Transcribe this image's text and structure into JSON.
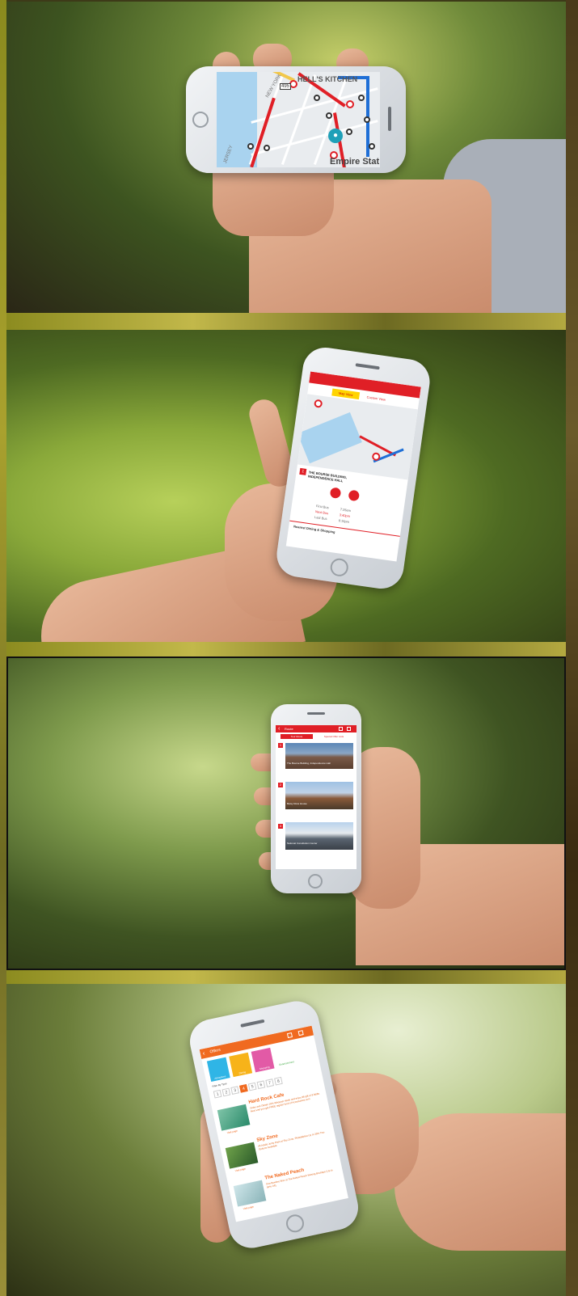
{
  "panel1": {
    "map": {
      "labels": [
        "HELL'S KITCHEN",
        "NEW YORK",
        "495",
        "JERSEY",
        "Empire Stat"
      ]
    }
  },
  "panel2": {
    "toggle": {
      "map_view": "Map View",
      "custom_view": "Custom View"
    },
    "stop_number": "1",
    "stop_name": "THE BOURSE BUILDING, INDEPENDENCE HALL",
    "times": [
      {
        "label": "First Bus",
        "time": "7:25am"
      },
      {
        "label": "Next Bus",
        "time": "3:40pm"
      },
      {
        "label": "Last Bus",
        "time": "6:15pm"
      }
    ],
    "footer": "Nearest Dining & Shopping"
  },
  "panel3": {
    "header": {
      "back_icon": "chevron-left-icon",
      "title": "Route"
    },
    "tabs": [
      "Tour Route",
      "Special Offer Lists"
    ],
    "stops": [
      {
        "num": "1",
        "name": "The Bourse Building, Independence Hall"
      },
      {
        "num": "2",
        "name": "Betsy Ross House"
      },
      {
        "num": "3",
        "name": "National Constitution Center"
      }
    ]
  },
  "panel4": {
    "header": {
      "title": "Offers"
    },
    "categories": [
      "Attractions",
      "Dining",
      "Shopping",
      "Entertainment"
    ],
    "sort_label": "Filter By Type",
    "pages": [
      "1",
      "2",
      "3",
      "4",
      "5",
      "6",
      "7",
      "8"
    ],
    "offers": [
      {
        "name": "Hard Rock Cafe",
        "desc": "Order and Obtain 10% Whopper steak and enjoy $6 gift of $ fiddle. Next visit you get FREE regular food of Accessories.com",
        "link": "Visit page"
      },
      {
        "name": "Sky Zone",
        "desc": "All Adults Jump Pass at Sky Zone, Philadelphia Up to 30% Two Options Available",
        "link": "Visit page"
      },
      {
        "name": "The Naked Peach",
        "desc": "One Bowline Wax at The Naked Peach Waxing Boutique (Up to 56% Off)",
        "link": "Visit page"
      }
    ]
  }
}
